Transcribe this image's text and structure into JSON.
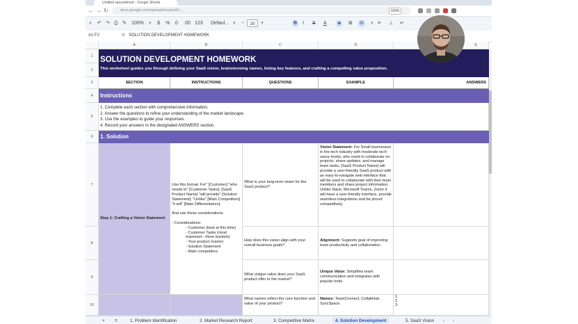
{
  "browser": {
    "tab_title": "Untitled spreadsheet - Google Sheets",
    "url": "docs.google.com/spreadsheets/d/1...",
    "zoom": "100%"
  },
  "toolbar": {
    "zoom": "100%",
    "currency": "$",
    "percent": "%",
    "decimal_dec": ".0",
    "decimal_inc": ".00",
    "number_format": "123",
    "font": "Defaul...",
    "font_size": "20",
    "bold": "B",
    "italic": "I",
    "strike": "S",
    "text_color": "A"
  },
  "formula_bar": {
    "cell_ref": "A1:F2",
    "fx": "fx",
    "content": "SOLUTION DEVELOPMENT HOMEWORK"
  },
  "columns": [
    "A",
    "B",
    "C",
    "D",
    "E"
  ],
  "rows": [
    "1",
    "2",
    "3",
    "4",
    "5",
    "6",
    "7",
    "8",
    "9",
    "10"
  ],
  "sheet": {
    "title": "SOLUTION DEVELOPMENT HOMEWORK",
    "subtitle": "This worksheet guides you through defining your SaaS vision, brainstorming names, listing key features, and crafting a compelling value proposition.",
    "headers": [
      "SECTION",
      "INSTRUCTIONS",
      "QUESTIONS",
      "EXAMPLE",
      "ANSWERS"
    ],
    "instructions_header": "Instructions",
    "instructions": [
      "1. Complete each section with comprehensive information.",
      "2. Answer the questions to refine your understanding of the market landscape.",
      "3. Use the examples to guide your responses.",
      "4. Record your answers in the designated ANSWERS section."
    ],
    "solution_header": "1. Solution",
    "step1_label": "Step 1: Crafting a Vision Statement",
    "step1_instructions_a": "Use this format: For\" [Customer] \"who needs to\" [Customer Tasks], [SaaS Product Name] \"will provide\" [Solution Statement]. \"Unlike\" [Main Competitors] \"it will\" [Main Differentiators].",
    "step1_instructions_b": "And use these considerations.",
    "considerations_label": "- Considerations:",
    "considerations": [
      "- Customer (best at this time)",
      "- Customer Tasks (most important - three buckets)",
      "- Your product (name)",
      "- Solution Statement",
      "- Main competitors"
    ],
    "q1": "What is your long-term vision for the SaaS product?",
    "ex1_label": "Vision Statement:",
    "ex1_text": "For Small businesses in the tech industry with moderate tech-savvy levels, who need to collaborate on projects, share updates, and manage team tasks, [SaaS Product Name] will provide a user-friendly SaaS product with an easy-to-navigate web interface that will be used to collaborate with their team members and share project information. Unlike Slack, Microsoft Teams, Zoom it will have a user-friendly interface, provide seamless integrations and be priced competitively.",
    "q2": "How does this vision align with your overall business goals?",
    "ex2_label": "Alignment:",
    "ex2_text": "Supports goal of improving team productivity and collaboration.",
    "q3": "What unique value does your SaaS product offer to the market?",
    "ex3_label": "Unique Value:",
    "ex3_text": "Simplifies team communication and integrates with popular tools.",
    "q4": "What names reflect the core function and value of your product?",
    "ex4_label": "Names:",
    "ex4_text": "TeamConnect, CollabHub, SyncSpace.",
    "answer_list": [
      "1.",
      "2.",
      "3."
    ]
  },
  "sheet_tabs": {
    "add": "+",
    "all": "≡",
    "tabs": [
      "1. Problem Identification",
      "2. Market Research Report",
      "3. Competitive Matrix",
      "4. Solution Development",
      "5. SaaS Vision"
    ],
    "active_index": 3
  }
}
